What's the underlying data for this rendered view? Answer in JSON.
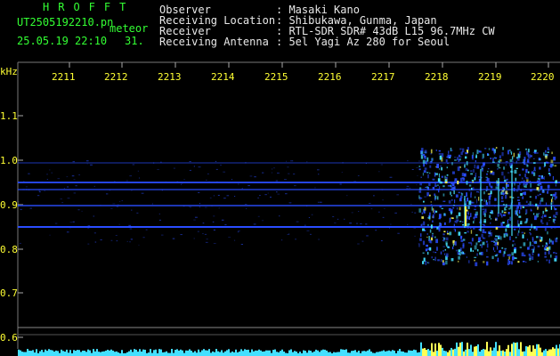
{
  "header": {
    "logo": "HROFFT",
    "filename": "UT2505192210.pn",
    "mode": "meteor",
    "datetime": "25.05.19 22:10",
    "count": "31.",
    "fields": [
      {
        "label": "Observer",
        "value": ": Masaki Kano"
      },
      {
        "label": "Receiving Location",
        "value": ": Shibukawa, Gunma, Japan"
      },
      {
        "label": "Receiver",
        "value": ": RTL-SDR SDR# 43dB L15 96.7MHz CW"
      },
      {
        "label": "Receiving Antenna",
        "value": ": 5el Yagi Az 280 for Seoul"
      }
    ]
  },
  "axes": {
    "y_unit": "kHz",
    "y_ticks": [
      "1.1",
      "1.0",
      "0.9",
      "0.8",
      "0.7",
      "0.6"
    ],
    "x_ticks": [
      "2211",
      "2212",
      "2213",
      "2214",
      "2215",
      "2216",
      "2217",
      "2218",
      "2219",
      "2220"
    ]
  },
  "colors": {
    "background": "#000000",
    "text_green": "#33ff33",
    "text_white": "#e8e8e8",
    "axis_yellow": "#ffff33",
    "signal_blue": "#2a4dff",
    "signal_cyan": "#44e0ff",
    "signal_hot": "#ffff55"
  }
}
